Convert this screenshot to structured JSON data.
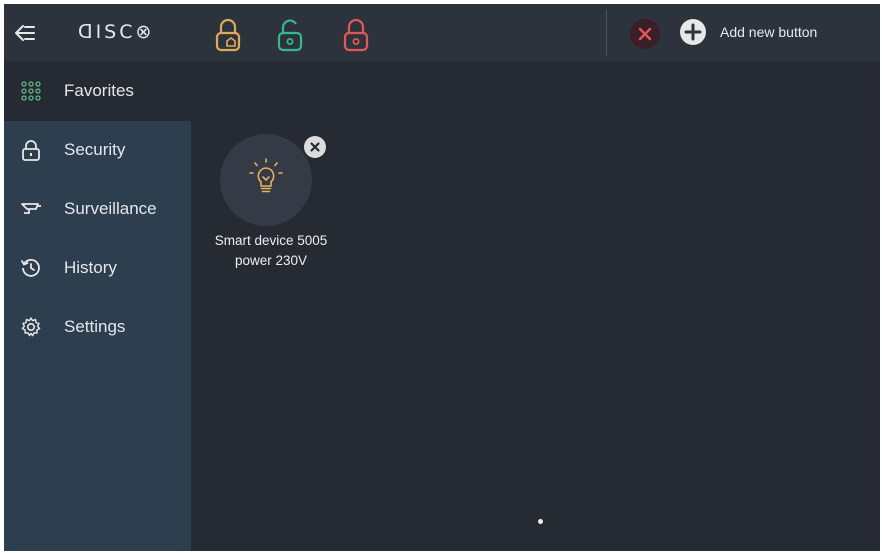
{
  "brand": {
    "logo_text": "ꓷISC⊗"
  },
  "topbar": {
    "arm_icons": [
      {
        "name": "partial-arm-icon",
        "color": "#e0a95a"
      },
      {
        "name": "disarm-icon",
        "color": "#35b98a"
      },
      {
        "name": "full-arm-icon",
        "color": "#e2585a"
      }
    ],
    "cancel_color": "#e2585a",
    "add_label": "Add new button"
  },
  "sidebar": {
    "items": [
      {
        "label": "Favorites",
        "icon": "grid-dots-icon",
        "active": true,
        "icon_color": "#5fb88a"
      },
      {
        "label": "Security",
        "icon": "lock-icon",
        "active": false
      },
      {
        "label": "Surveillance",
        "icon": "camera-icon",
        "active": false
      },
      {
        "label": "History",
        "icon": "history-icon",
        "active": false
      },
      {
        "label": "Settings",
        "icon": "gear-icon",
        "active": false
      }
    ]
  },
  "favorites": {
    "devices": [
      {
        "name_line1": "Smart device 5005",
        "name_line2": "power 230V",
        "icon": "lightbulb-icon",
        "icon_color": "#e6b25a"
      }
    ]
  },
  "pager": {
    "current_page": 1,
    "total_pages": 1
  }
}
